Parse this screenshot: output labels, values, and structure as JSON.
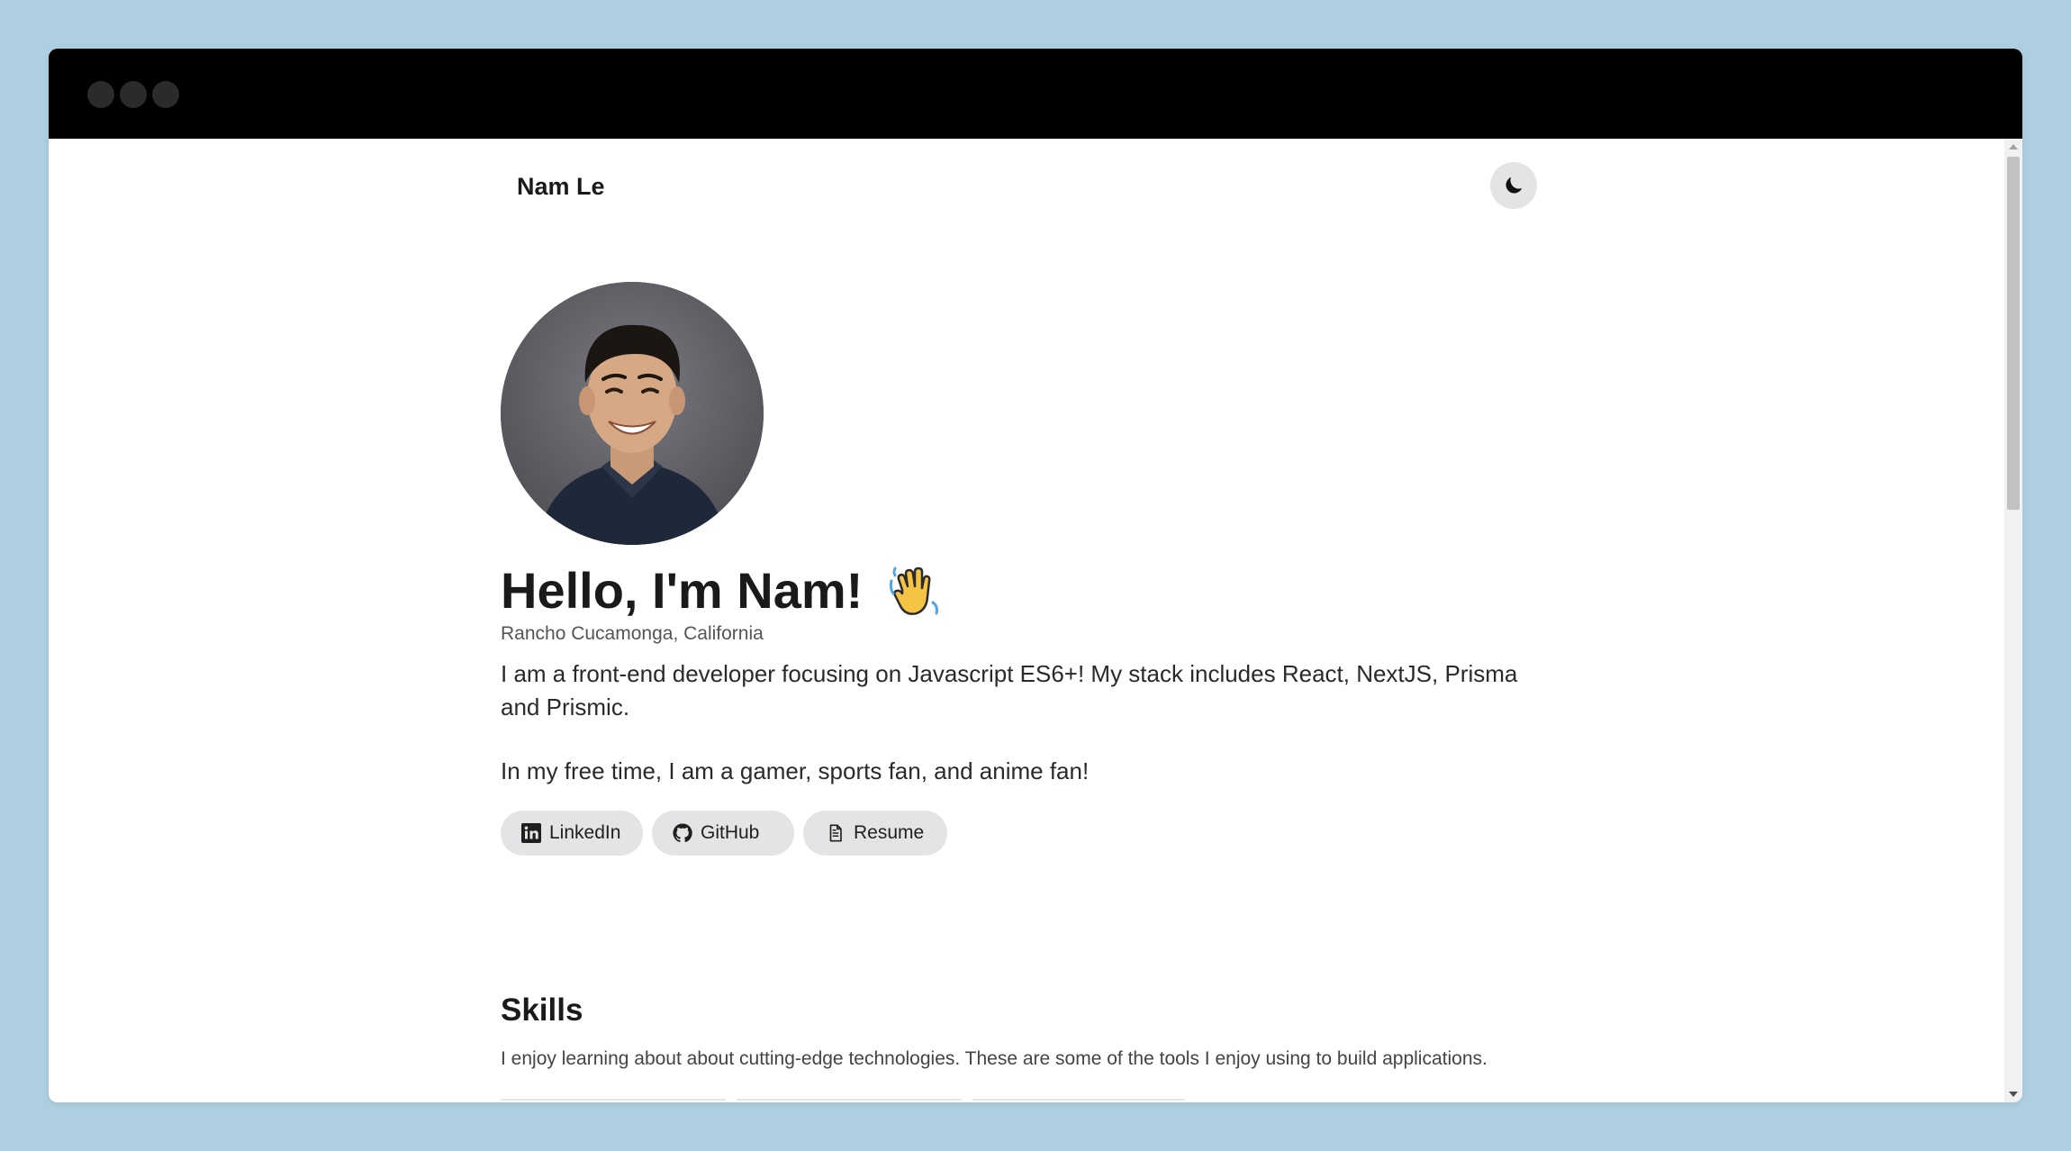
{
  "window": {
    "controls": [
      "close",
      "minimize",
      "maximize"
    ]
  },
  "header": {
    "brand": "Nam Le",
    "theme_toggle_icon": "moon-icon"
  },
  "hero": {
    "avatar_alt": "profile-photo",
    "title": "Hello, I'm Nam!",
    "title_icon": "waving-hand-icon",
    "location": "Rancho Cucamonga, California",
    "bio": "I am a front-end developer focusing on Javascript ES6+! My stack includes React, NextJS, Prisma and Prismic.",
    "bio_2": "In my free time, I am a gamer, sports fan, and anime fan!"
  },
  "links": [
    {
      "label": "LinkedIn",
      "icon": "linkedin-icon"
    },
    {
      "label": "GitHub",
      "icon": "github-icon"
    },
    {
      "label": "Resume",
      "icon": "document-icon"
    }
  ],
  "skills": {
    "title": "Skills",
    "description": "I enjoy learning about about cutting-edge technologies. These are some of the tools I enjoy using to build applications."
  },
  "colors": {
    "page_background": "#aecfdf",
    "titlebar": "#000000",
    "pill_background": "#e4e4e7",
    "text_primary": "#1a1a1a",
    "text_secondary": "#555555"
  }
}
